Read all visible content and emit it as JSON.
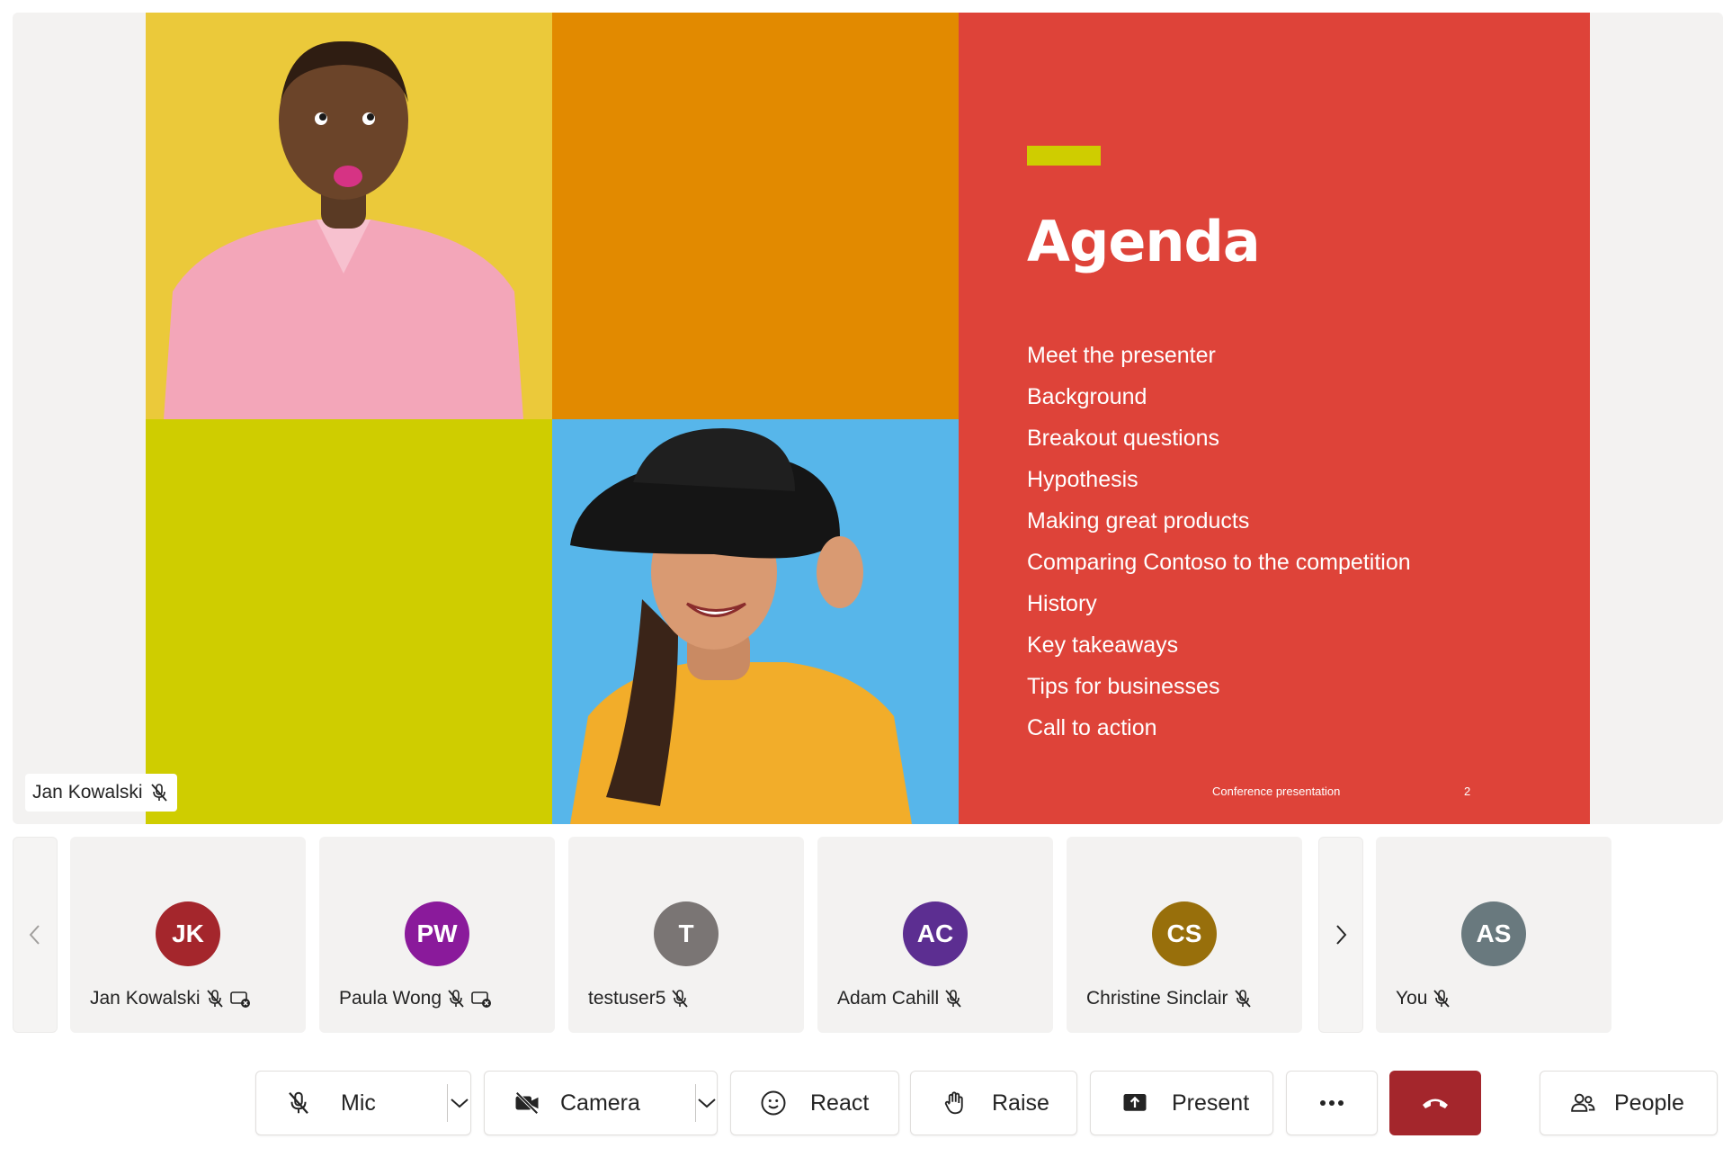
{
  "slide": {
    "title": "Agenda",
    "items": [
      "Meet the presenter",
      "Background",
      "Breakout questions",
      "Hypothesis",
      "Making great products",
      "Comparing Contoso to the competition",
      "History",
      "Key takeaways",
      "Tips for businesses",
      "Call to action"
    ],
    "footer": "Conference presentation",
    "page_number": "2",
    "colors": {
      "red": "#de4339",
      "orange": "#e28a00",
      "lime": "#cfcd00",
      "yellow": "#ebc93a",
      "blue": "#57b6ea"
    }
  },
  "presenter": {
    "name": "Jan Kowalski",
    "icon": "mic-off-icon"
  },
  "participants": [
    {
      "initials": "JK",
      "name": "Jan Kowalski",
      "color": "#a4262c",
      "icons": [
        "mic-off-icon",
        "screen-share-off-icon"
      ]
    },
    {
      "initials": "PW",
      "name": "Paula Wong",
      "color": "#8a1a9b",
      "icons": [
        "mic-off-icon",
        "screen-share-off-icon"
      ]
    },
    {
      "initials": "T",
      "name": "testuser5",
      "color": "#7a7574",
      "icons": [
        "mic-off-icon"
      ]
    },
    {
      "initials": "AC",
      "name": "Adam Cahill",
      "color": "#5c2e91",
      "icons": [
        "mic-off-icon"
      ]
    },
    {
      "initials": "CS",
      "name": "Christine Sinclair",
      "color": "#986f0b",
      "icons": [
        "mic-off-icon"
      ]
    },
    {
      "initials": "AS",
      "name": "You",
      "color": "#69797e",
      "icons": [
        "mic-off-icon"
      ]
    }
  ],
  "controls": {
    "mic": "Mic",
    "camera": "Camera",
    "react": "React",
    "raise": "Raise",
    "present": "Present",
    "people": "People",
    "hangup_color": "#a4262c"
  }
}
